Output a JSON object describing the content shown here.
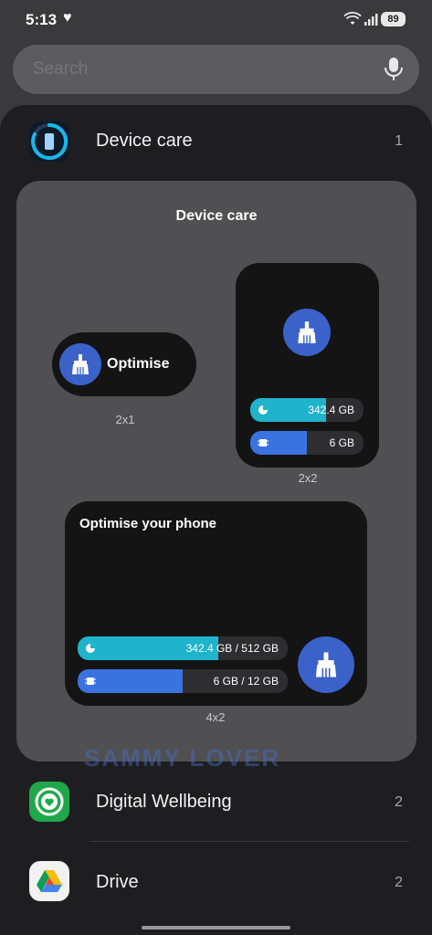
{
  "status": {
    "time": "5:13",
    "battery": "89"
  },
  "search": {
    "placeholder": "Search"
  },
  "apps": [
    {
      "name": "Device care",
      "count": "1"
    },
    {
      "name": "Digital Wellbeing",
      "count": "2"
    },
    {
      "name": "Drive",
      "count": "2"
    }
  ],
  "preview": {
    "title": "Device care",
    "widget_1x": {
      "label": "Optimise",
      "size": "2x1"
    },
    "widget_2x2": {
      "storage_text": "342.4 GB",
      "storage_fill": 0.67,
      "memory_text": "6 GB",
      "memory_fill": 0.5,
      "size": "2x2"
    },
    "widget_4x2": {
      "title": "Optimise your phone",
      "storage_text": "342.4 GB / 512 GB",
      "storage_fill": 0.67,
      "memory_text": "6 GB / 12 GB",
      "memory_fill": 0.5,
      "size": "4x2"
    }
  },
  "watermark": "SAMMY LOVER",
  "colors": {
    "storage_bar": "#1fb3cc",
    "memory_bar": "#3a72e0",
    "accent_blue": "#3a62c8"
  }
}
